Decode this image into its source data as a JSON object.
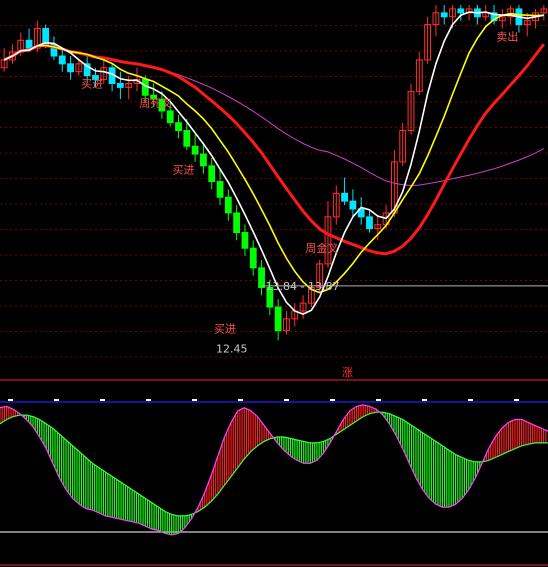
{
  "chart_data": [
    {
      "type": "candlestick",
      "panel": "price",
      "title": "",
      "xlabel": "",
      "ylabel": "",
      "ylim": [
        11.9,
        21.0
      ],
      "grid": true,
      "colors": {
        "up": "#ff3030",
        "down": "#00e5ff",
        "down_alt": "#00ff00",
        "ma_white": "#ffffff",
        "ma_yellow": "#ffff00",
        "ma_red": "#ff1a1a",
        "ma_magenta": "#d040d0",
        "grid": "#7a0000",
        "border": "#ff2020",
        "price_line": "#b0b0b0"
      },
      "candles": [
        [
          19.4,
          19.9,
          19.3,
          19.6
        ],
        [
          19.6,
          20.0,
          19.5,
          19.8
        ],
        [
          19.8,
          20.3,
          19.7,
          20.1
        ],
        [
          20.1,
          20.4,
          19.8,
          19.9
        ],
        [
          19.9,
          20.6,
          19.8,
          20.4
        ],
        [
          20.4,
          20.5,
          19.9,
          20.0
        ],
        [
          20.0,
          20.2,
          19.6,
          19.7
        ],
        [
          19.7,
          19.9,
          19.3,
          19.5
        ],
        [
          19.5,
          19.7,
          19.1,
          19.3
        ],
        [
          19.3,
          19.6,
          19.2,
          19.5
        ],
        [
          19.5,
          19.7,
          19.0,
          19.2
        ],
        [
          19.2,
          19.4,
          18.9,
          19.1
        ],
        [
          19.1,
          19.6,
          19.0,
          19.4
        ],
        [
          19.4,
          19.5,
          18.8,
          19.0
        ],
        [
          19.0,
          19.3,
          18.6,
          18.9
        ],
        [
          18.9,
          19.2,
          18.6,
          19.0
        ],
        [
          19.0,
          19.4,
          18.8,
          19.1
        ],
        [
          19.1,
          19.2,
          18.5,
          18.7
        ],
        [
          18.7,
          19.0,
          18.4,
          18.6
        ],
        [
          18.6,
          18.8,
          18.1,
          18.3
        ],
        [
          18.3,
          18.5,
          17.9,
          18.0
        ],
        [
          18.0,
          18.2,
          17.6,
          17.8
        ],
        [
          17.8,
          18.1,
          17.3,
          17.4
        ],
        [
          17.4,
          17.7,
          17.0,
          17.2
        ],
        [
          17.2,
          17.5,
          16.7,
          16.9
        ],
        [
          16.9,
          17.1,
          16.3,
          16.5
        ],
        [
          16.5,
          16.8,
          15.9,
          16.1
        ],
        [
          16.1,
          16.3,
          15.5,
          15.7
        ],
        [
          15.7,
          15.9,
          15.0,
          15.2
        ],
        [
          15.2,
          15.4,
          14.6,
          14.8
        ],
        [
          14.8,
          15.0,
          14.1,
          14.3
        ],
        [
          14.3,
          14.5,
          13.6,
          13.8
        ],
        [
          13.8,
          14.0,
          13.1,
          13.3
        ],
        [
          13.3,
          13.5,
          12.45,
          12.7
        ],
        [
          12.7,
          13.2,
          12.6,
          13.0
        ],
        [
          13.0,
          13.4,
          12.8,
          13.2
        ],
        [
          13.2,
          13.6,
          13.0,
          13.4
        ],
        [
          13.4,
          13.9,
          13.3,
          13.8
        ],
        [
          13.8,
          14.5,
          13.7,
          14.4
        ],
        [
          14.4,
          16.0,
          14.3,
          15.6
        ],
        [
          15.6,
          16.4,
          15.4,
          16.2
        ],
        [
          16.2,
          16.6,
          15.9,
          16.0
        ],
        [
          16.0,
          16.3,
          15.6,
          15.8
        ],
        [
          15.8,
          16.1,
          15.4,
          15.6
        ],
        [
          15.6,
          15.8,
          15.2,
          15.3
        ],
        [
          15.3,
          15.6,
          15.0,
          15.4
        ],
        [
          15.4,
          15.9,
          15.3,
          15.7
        ],
        [
          15.7,
          17.3,
          15.6,
          17.0
        ],
        [
          17.0,
          18.0,
          16.9,
          17.8
        ],
        [
          17.8,
          19.0,
          17.7,
          18.8
        ],
        [
          18.8,
          19.8,
          18.7,
          19.6
        ],
        [
          19.6,
          20.7,
          19.5,
          20.5
        ],
        [
          20.5,
          21.0,
          20.2,
          20.8
        ],
        [
          20.8,
          21.0,
          20.5,
          20.7
        ],
        [
          20.7,
          21.0,
          20.4,
          20.9
        ],
        [
          20.9,
          21.0,
          20.6,
          20.8
        ],
        [
          20.8,
          21.0,
          20.6,
          20.9
        ],
        [
          20.9,
          21.0,
          20.5,
          20.7
        ],
        [
          20.7,
          21.0,
          20.6,
          20.8
        ],
        [
          20.8,
          21.0,
          20.5,
          20.6
        ],
        [
          20.6,
          20.9,
          20.4,
          20.7
        ],
        [
          20.7,
          21.0,
          20.5,
          20.9
        ],
        [
          20.9,
          21.0,
          20.3,
          20.5
        ],
        [
          20.5,
          20.8,
          20.2,
          20.6
        ],
        [
          20.6,
          20.9,
          20.4,
          20.8
        ],
        [
          20.8,
          21.0,
          20.6,
          20.9
        ]
      ],
      "annotations": [
        {
          "text": "买进",
          "color": "#ff5050",
          "index": 10,
          "price": 18.9
        },
        {
          "text": "周死叉",
          "color": "#ff5050",
          "index": 17,
          "price": 18.4
        },
        {
          "text": "买进",
          "color": "#ff5050",
          "index": 21,
          "price": 16.7
        },
        {
          "text": "周金叉",
          "color": "#ff5050",
          "index": 37,
          "price": 14.7
        },
        {
          "text": "买进",
          "color": "#ff5050",
          "index": 26,
          "price": 12.65
        },
        {
          "text": "卖出",
          "color": "#ff5050",
          "index": 60,
          "price": 20.1
        }
      ],
      "price_line": {
        "text": "13.84 - 13.87",
        "price": 13.84,
        "from_index": 31
      },
      "low_marker": {
        "text": "12.45",
        "price": 12.45,
        "index": 26
      },
      "badge": {
        "text": "涨",
        "color": "#ff3030"
      }
    },
    {
      "type": "area",
      "panel": "oscillator",
      "title": "",
      "xlabel": "",
      "ylabel": "",
      "ylim": [
        0,
        100
      ],
      "grid": false,
      "colors": {
        "fast_line": "#ff40ff",
        "slow_line": "#40ff40",
        "up_fill": "#ff2020",
        "down_fill": "#20ff20",
        "fast_up": "#ff40ff",
        "fast_down": "#80c0a0",
        "top_line": "#2020ff",
        "bottom_line": "#ffffff"
      },
      "fast": [
        96,
        97,
        95,
        92,
        88,
        83,
        76,
        68,
        58,
        48,
        40,
        34,
        30,
        27,
        26,
        24,
        22,
        21,
        20,
        19,
        18,
        17,
        15,
        13,
        12,
        10,
        9,
        10,
        14,
        20,
        28,
        38,
        50,
        63,
        76,
        86,
        94,
        96,
        94,
        90,
        84,
        78,
        72,
        67,
        63,
        60,
        58,
        58,
        60,
        65,
        72,
        80,
        88,
        94,
        97,
        98,
        97,
        95,
        91,
        85,
        77,
        68,
        58,
        48,
        40,
        34,
        30,
        28,
        28,
        30,
        34,
        40,
        48,
        58,
        68,
        76,
        82,
        86,
        88,
        88,
        86,
        84,
        82,
        80
      ],
      "slow": [
        85,
        88,
        90,
        91,
        91,
        90,
        88,
        85,
        82,
        78,
        74,
        70,
        66,
        62,
        58,
        55,
        52,
        49,
        46,
        43,
        40,
        37,
        34,
        31,
        28,
        25,
        23,
        22,
        22,
        23,
        25,
        28,
        32,
        37,
        43,
        49,
        55,
        61,
        66,
        70,
        73,
        75,
        76,
        76,
        75,
        74,
        73,
        72,
        72,
        73,
        75,
        78,
        81,
        84,
        87,
        90,
        92,
        93,
        93,
        92,
        90,
        88,
        85,
        82,
        79,
        76,
        73,
        70,
        67,
        64,
        62,
        60,
        59,
        59,
        60,
        62,
        64,
        66,
        68,
        70,
        71,
        72,
        72,
        72
      ]
    }
  ]
}
